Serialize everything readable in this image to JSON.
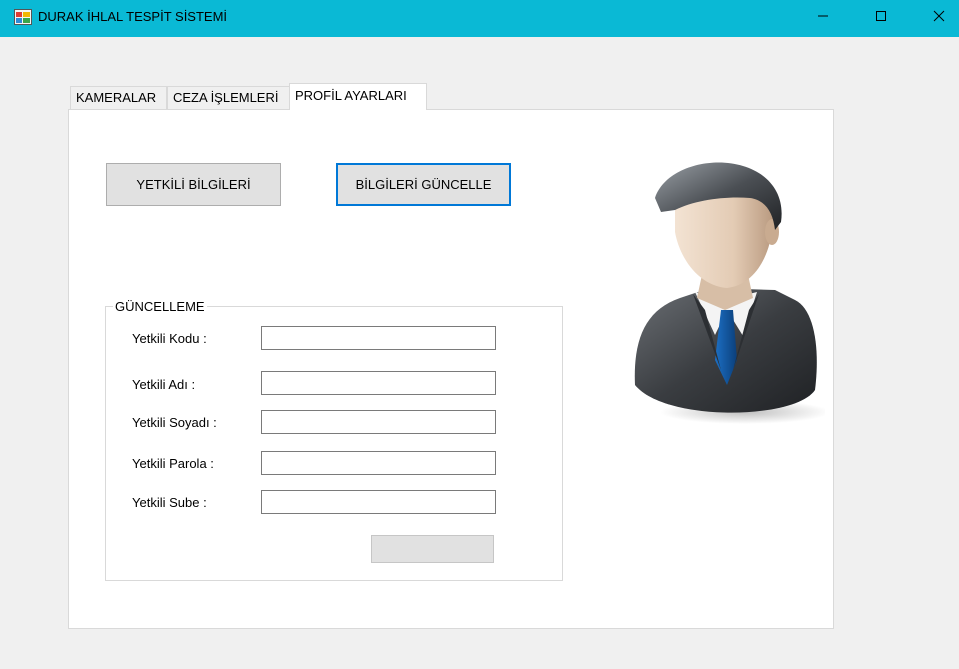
{
  "window": {
    "title": "DURAK İHLAL TESPİT SİSTEMİ",
    "minimize_icon": "minimize-icon",
    "maximize_icon": "maximize-icon",
    "close_icon": "close-icon"
  },
  "tabs": [
    {
      "label": "KAMERALAR"
    },
    {
      "label": "CEZA İŞLEMLERİ"
    },
    {
      "label": "PROFİL AYARLARI",
      "active": true
    }
  ],
  "buttons": {
    "yetkili_bilgileri": "YETKİLİ BİLGİLERİ",
    "bilgileri_guncelle": "BİLGİLERİ GÜNCELLE",
    "submit": ""
  },
  "group": {
    "title": "GÜNCELLEME",
    "fields": [
      {
        "label": "Yetkili Kodu :",
        "value": ""
      },
      {
        "label": "Yetkili Adı :",
        "value": ""
      },
      {
        "label": "Yetkili Soyadı :",
        "value": ""
      },
      {
        "label": "Yetkili Parola :",
        "value": ""
      },
      {
        "label": "Yetkili Sube :",
        "value": ""
      }
    ]
  },
  "image": {
    "icon": "user-profile-icon"
  },
  "colors": {
    "titlebar": "#0ab9d5",
    "focus_border": "#0078d7"
  }
}
